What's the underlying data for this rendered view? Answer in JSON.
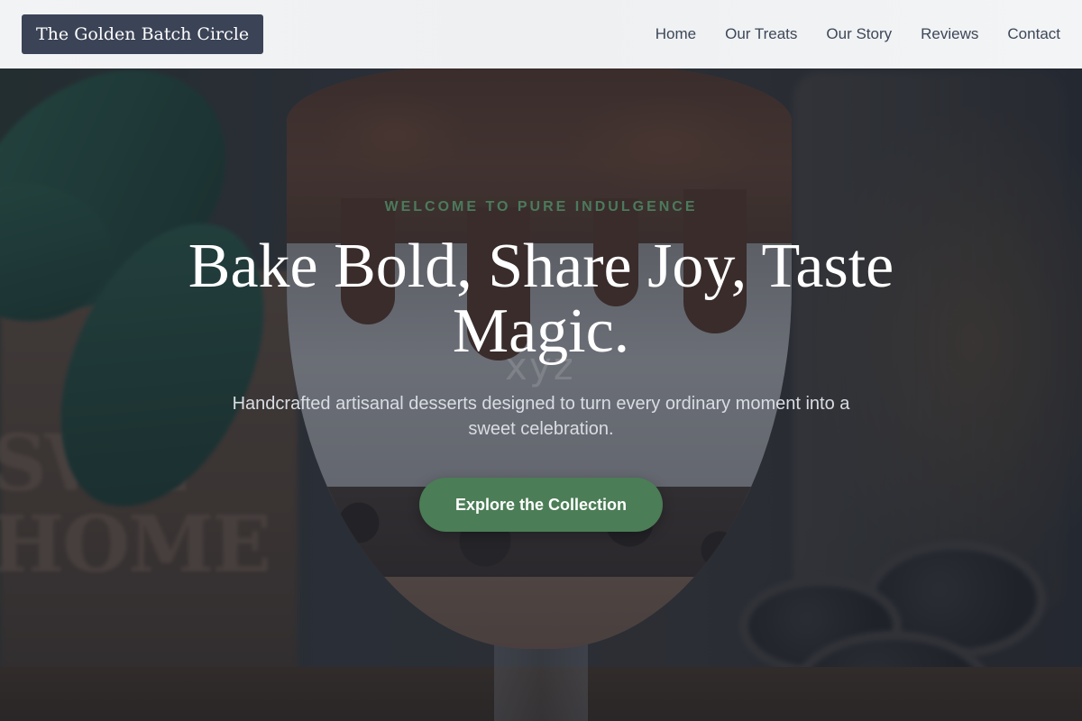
{
  "header": {
    "brand": "The Golden Batch Circle",
    "nav": [
      {
        "label": "Home"
      },
      {
        "label": "Our Treats"
      },
      {
        "label": "Our Story"
      },
      {
        "label": "Reviews"
      },
      {
        "label": "Contact"
      }
    ]
  },
  "hero": {
    "eyebrow": "WELCOME TO PURE INDULGENCE",
    "title": "Bake Bold, Share Joy, Taste Magic.",
    "subtitle": "Handcrafted artisanal desserts designed to turn every ordinary moment into a sweet celebration.",
    "cta_label": "Explore the Collection",
    "watermark": "xyz"
  },
  "colors": {
    "accent": "#4b7d56",
    "eyebrow": "#4c7a5c",
    "brand_bg": "#3b4356",
    "header_bg": "#f2f3f5",
    "nav_text": "#3d4758"
  }
}
